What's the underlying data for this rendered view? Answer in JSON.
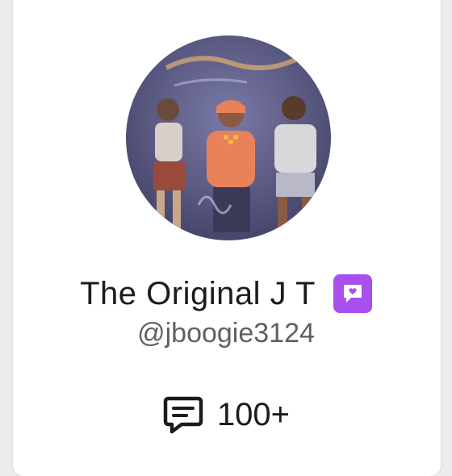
{
  "profile": {
    "display_name": "The Original J T",
    "username": "@jboogie3124",
    "avatar": {
      "icon": "profile-photo",
      "colors": {
        "background": "#5a5a8a",
        "figure_jacket": "#e8825a",
        "figure_shirt": "#d8d8d8",
        "figure_skirt": "#9a4a3a"
      }
    },
    "badge": {
      "icon": "heart-chat-icon",
      "color": "#a94ff0"
    },
    "stats": {
      "icon": "comment-icon",
      "count": "100+"
    }
  }
}
